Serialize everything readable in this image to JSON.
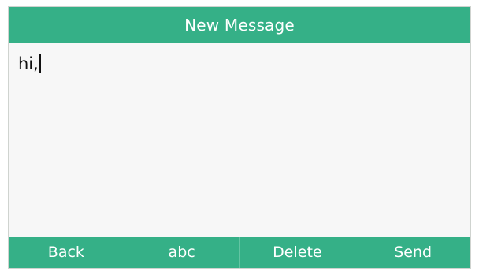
{
  "header": {
    "title": "New Message"
  },
  "message": {
    "text": "hi,"
  },
  "softkeys": {
    "back": "Back",
    "mode": "abc",
    "delete": "Delete",
    "send": "Send"
  },
  "colors": {
    "accent": "#35b087",
    "background": "#f7f7f7",
    "text": "#111111"
  }
}
